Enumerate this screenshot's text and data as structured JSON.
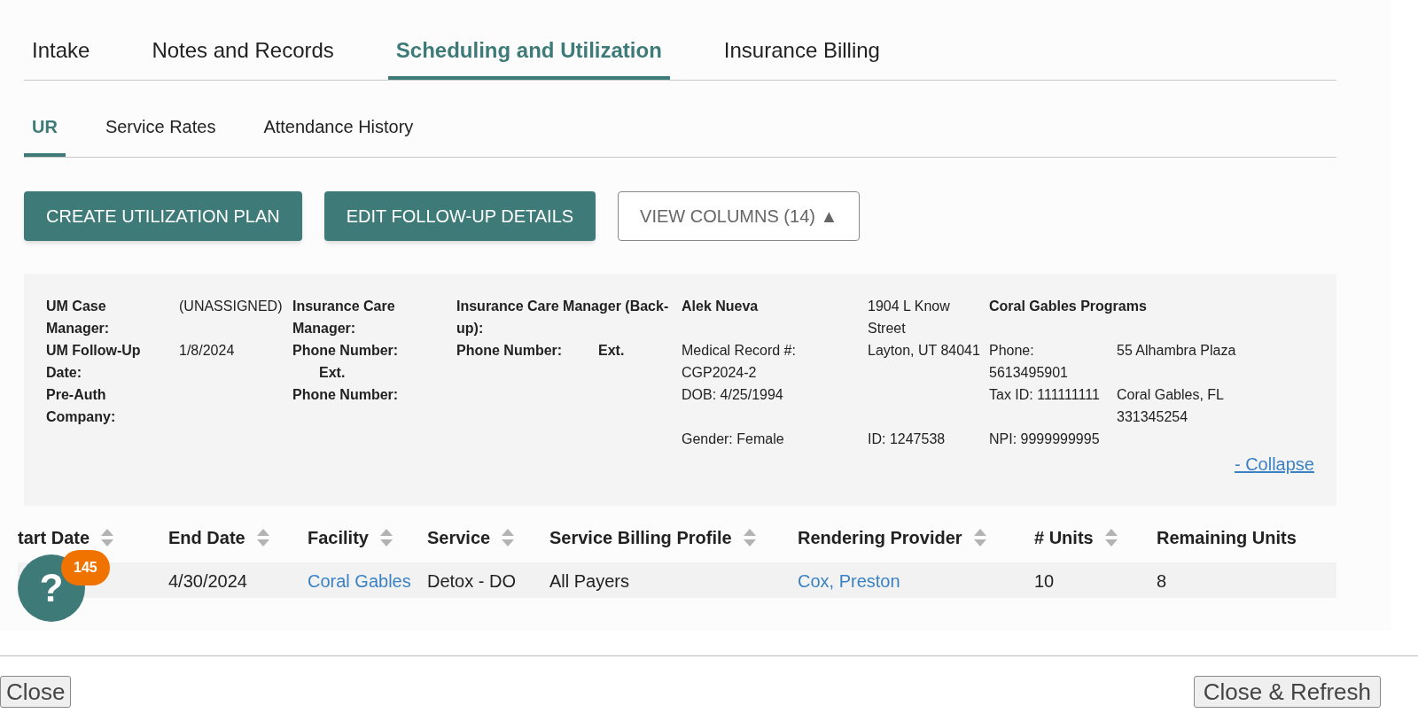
{
  "tabs": [
    {
      "label": "Intake",
      "selected": false
    },
    {
      "label": "Notes and Records",
      "selected": false
    },
    {
      "label": "Scheduling and Utilization",
      "selected": true
    },
    {
      "label": "Insurance Billing",
      "selected": false
    }
  ],
  "subtabs": [
    {
      "label": "UR",
      "selected": true
    },
    {
      "label": "Service Rates",
      "selected": false
    },
    {
      "label": "Attendance History",
      "selected": false
    }
  ],
  "actions": [
    {
      "label": "CREATE UTILIZATION PLAN",
      "kind": "primary"
    },
    {
      "label": "EDIT FOLLOW-UP DETAILS",
      "kind": "primary"
    },
    {
      "label": "VIEW COLUMNS (14) ▲",
      "kind": "outline"
    }
  ],
  "info_panel": {
    "um_fields": [
      {
        "label": "UM Case Manager:",
        "value": "(UNASSIGNED)"
      },
      {
        "label": "UM Follow-Up Date:",
        "value": "1/8/2024"
      },
      {
        "label": "Pre-Auth Company:"
      }
    ],
    "insurance_care_manager": [
      {
        "text": "Insurance Care Manager:",
        "kind": "label"
      },
      {
        "text": "Phone Number:",
        "kind": "label"
      },
      {
        "text": "Ext.",
        "kind": "ext"
      },
      {
        "text": "Phone Number:",
        "kind": "label"
      }
    ],
    "backup_manager": {
      "title": "Insurance Care Manager (Back-up):",
      "phone": "Phone Number:",
      "ext": "Ext."
    },
    "rows": [
      {
        "patient": "Alek Nueva",
        "address": "1904 L Know Street",
        "facility_name": "Coral Gables Programs"
      },
      {
        "patient": "Medical Record #: CGP2024-2",
        "address": "Layton, UT 84041",
        "facility": "Phone: 5613495901",
        "facility_address": "55 Alhambra Plaza"
      },
      {
        "patient": "DOB: 4/25/1994",
        "facility": "Tax ID: 111111111",
        "facility_address": "Coral Gables, FL 331345254"
      },
      {
        "patient": "Gender: Female",
        "address": "ID: 1247538",
        "facility": "NPI: 9999999995"
      }
    ],
    "collapse_link": "- Collapse"
  },
  "table": {
    "columns": [
      "tart Date",
      "End Date",
      "Facility",
      "Service",
      "Service Billing Profile",
      "Rendering Provider",
      "# Units",
      "Remaining Units"
    ],
    "rows": [
      [
        "",
        {
          "text": "4/30/2024",
          "kind": "plain"
        },
        {
          "text": "Coral Gables",
          "kind": "link"
        },
        {
          "text": "Detox - DO",
          "kind": "plain"
        },
        {
          "text": "All Payers",
          "kind": "plain"
        },
        {
          "text": "Cox, Preston",
          "kind": "link"
        },
        {
          "text": "10",
          "kind": "plain"
        },
        {
          "text": "8",
          "kind": "plain"
        }
      ]
    ]
  },
  "help": {
    "label": "?",
    "badge": "145"
  },
  "footer": {
    "close": "Close",
    "close_refresh": "Close & Refresh"
  }
}
